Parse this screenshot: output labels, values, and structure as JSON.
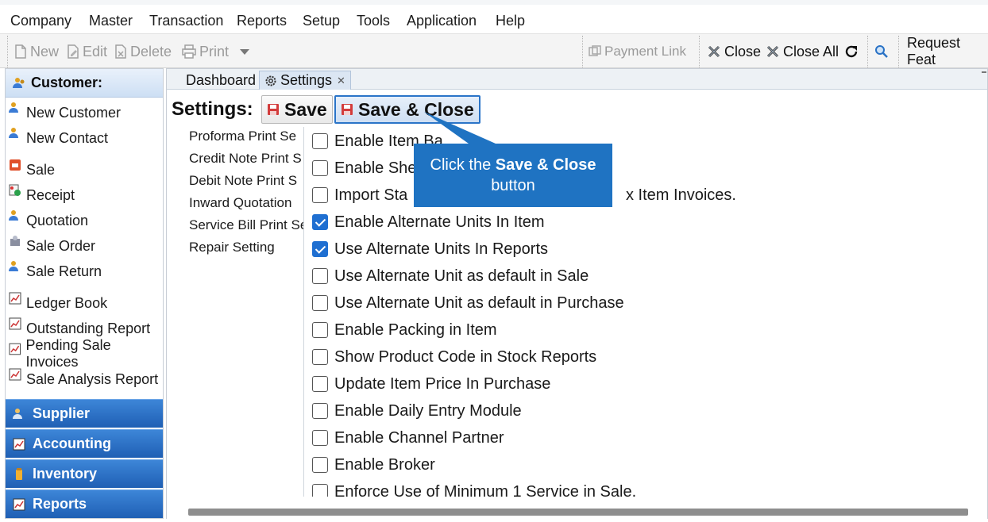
{
  "menubar": {
    "items": [
      "Company",
      "Master",
      "Transaction",
      "Reports",
      "Setup",
      "Tools",
      "Application",
      "Help"
    ]
  },
  "toolbar": {
    "new_label": "New",
    "edit_label": "Edit",
    "delete_label": "Delete",
    "print_label": "Print",
    "payment_link_label": "Payment Link",
    "close_label": "Close",
    "close_all_label": "Close All",
    "request_feature_label": "Request Feat"
  },
  "leftnav": {
    "header": "Customer:",
    "items": [
      "New Customer",
      "New Contact",
      "Sale",
      "Receipt",
      "Quotation",
      "Sale Order",
      "Sale Return",
      "Ledger Book",
      "Outstanding Report",
      "Pending Sale Invoices",
      "Sale Analysis Report"
    ],
    "groups": [
      "Supplier",
      "Accounting",
      "Inventory",
      "Reports"
    ]
  },
  "tabs": {
    "dashboard": "Dashboard",
    "settings": "Settings"
  },
  "settings": {
    "title": "Settings:",
    "save_label": "Save",
    "save_close_label": "Save & Close",
    "menu": [
      "Proforma Print Se",
      "Credit Note Print S",
      "Debit Note Print S",
      "Inward Quotation",
      "Service Bill Print Se",
      "Repair Setting"
    ],
    "options": [
      {
        "label": "Enable Item Ba",
        "checked": false
      },
      {
        "label": "Enable She",
        "checked": false
      },
      {
        "label": "Import Sta",
        "checked": false
      },
      {
        "label": "Enable Alternate Units In Item",
        "checked": true
      },
      {
        "label": "Use Alternate Units In Reports",
        "checked": true
      },
      {
        "label": "Use Alternate Unit as default in Sale",
        "checked": false
      },
      {
        "label": "Use Alternate Unit as default in Purchase",
        "checked": false
      },
      {
        "label": "Enable Packing in Item",
        "checked": false
      },
      {
        "label": "Show Product Code in Stock Reports",
        "checked": false
      },
      {
        "label": "Update Item Price In Purchase",
        "checked": false
      },
      {
        "label": "Enable Daily Entry Module",
        "checked": false
      },
      {
        "label": "Enable Channel Partner",
        "checked": false
      },
      {
        "label": "Enable Broker",
        "checked": false
      },
      {
        "label": "Enforce Use of Minimum 1 Service in Sale.",
        "checked": false
      }
    ],
    "option_tail": "x Item Invoices."
  },
  "callout": {
    "pre": "Click the",
    "bold": "Save & Close",
    "post": "button"
  },
  "colors": {
    "accent": "#1f73c2",
    "nav_group": "#2a6fc4",
    "checkbox_checked": "#1f6fd1"
  }
}
